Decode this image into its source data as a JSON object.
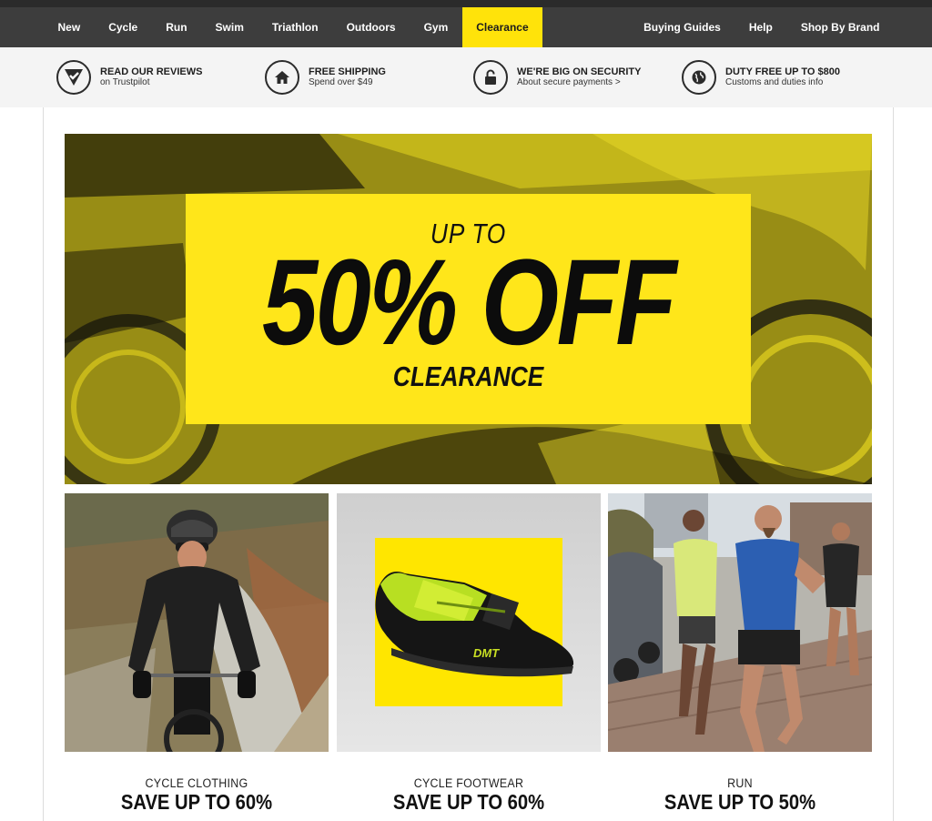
{
  "nav": {
    "left": [
      "New",
      "Cycle",
      "Run",
      "Swim",
      "Triathlon",
      "Outdoors",
      "Gym",
      "Clearance"
    ],
    "right": [
      "Buying Guides",
      "Help",
      "Shop By Brand"
    ],
    "active": "Clearance",
    "accent_color": "#ffe30a"
  },
  "usp": [
    {
      "title": "READ OUR REVIEWS",
      "subtitle": "on Trustpilot",
      "icon": "trustpilot-icon"
    },
    {
      "title": "FREE SHIPPING",
      "subtitle": "Spend over $49",
      "icon": "home-icon"
    },
    {
      "title": "WE'RE BIG ON SECURITY",
      "subtitle": "About secure payments >",
      "icon": "padlock-icon"
    },
    {
      "title": "DUTY FREE UP TO $800",
      "subtitle": "Customs and duties info",
      "icon": "globe-icon"
    }
  ],
  "hero": {
    "line1": "UP TO",
    "line2": "50% OFF",
    "line3": "CLEARANCE",
    "box_color": "#ffe61a"
  },
  "tiles": [
    {
      "label": "CYCLE CLOTHING",
      "offer": "SAVE UP TO 60%",
      "image": "cyclist-on-road"
    },
    {
      "label": "CYCLE FOOTWEAR",
      "offer": "SAVE UP TO 60%",
      "image": "cycling-shoe"
    },
    {
      "label": "RUN",
      "offer": "SAVE UP TO 50%",
      "image": "runners-on-street"
    }
  ]
}
